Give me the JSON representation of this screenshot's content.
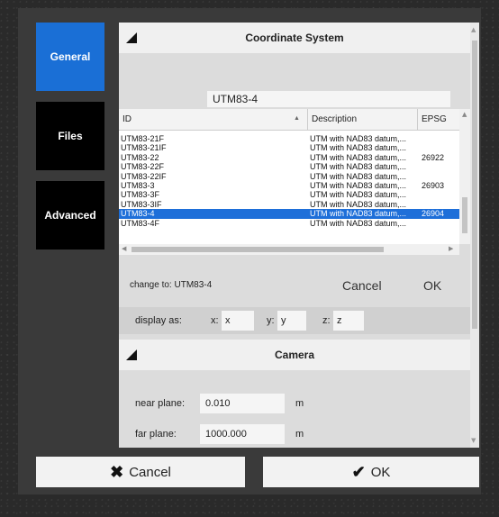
{
  "sidebar": {
    "general": "General",
    "files": "Files",
    "advanced": "Advanced"
  },
  "coordinate_system": {
    "title": "Coordinate System",
    "search_value": "UTM83-4",
    "columns": {
      "id": "ID",
      "description": "Description",
      "epsg": "EPSG"
    },
    "rows": [
      {
        "id": "UTM83-21F",
        "description": "UTM with NAD83 datum,...",
        "epsg": ""
      },
      {
        "id": "UTM83-21IF",
        "description": "UTM with NAD83 datum,...",
        "epsg": ""
      },
      {
        "id": "UTM83-22",
        "description": "UTM with NAD83 datum,...",
        "epsg": "26922"
      },
      {
        "id": "UTM83-22F",
        "description": "UTM with NAD83 datum,...",
        "epsg": ""
      },
      {
        "id": "UTM83-22IF",
        "description": "UTM with NAD83 datum,...",
        "epsg": ""
      },
      {
        "id": "UTM83-3",
        "description": "UTM with NAD83 datum,...",
        "epsg": "26903"
      },
      {
        "id": "UTM83-3F",
        "description": "UTM with NAD83 datum,...",
        "epsg": ""
      },
      {
        "id": "UTM83-3IF",
        "description": "UTM with NAD83 datum,...",
        "epsg": ""
      },
      {
        "id": "UTM83-4",
        "description": "UTM with NAD83 datum,...",
        "epsg": "26904"
      },
      {
        "id": "UTM83-4F",
        "description": "UTM with NAD83 datum,...",
        "epsg": ""
      }
    ],
    "selected_index": 8,
    "change_to": "change to: UTM83-4",
    "cancel_label": "Cancel",
    "ok_label": "OK",
    "display_as": {
      "label": "display as:",
      "x_label": "x:",
      "x_value": "x",
      "y_label": "y:",
      "y_value": "y",
      "z_label": "z:",
      "z_value": "z"
    }
  },
  "camera": {
    "title": "Camera",
    "near_plane_label": "near plane:",
    "near_plane_value": "0.010",
    "near_plane_unit": "m",
    "far_plane_label": "far plane:",
    "far_plane_value": "1000.000",
    "far_plane_unit": "m"
  },
  "footer": {
    "cancel_label": "Cancel",
    "ok_label": "OK"
  },
  "colors": {
    "accent": "#1a6fd6",
    "selection": "#1e6fd9"
  },
  "icons": {
    "cancel": "x-icon",
    "ok": "check-icon",
    "collapse": "triangle-icon",
    "sort": "sort-ascending-icon"
  }
}
